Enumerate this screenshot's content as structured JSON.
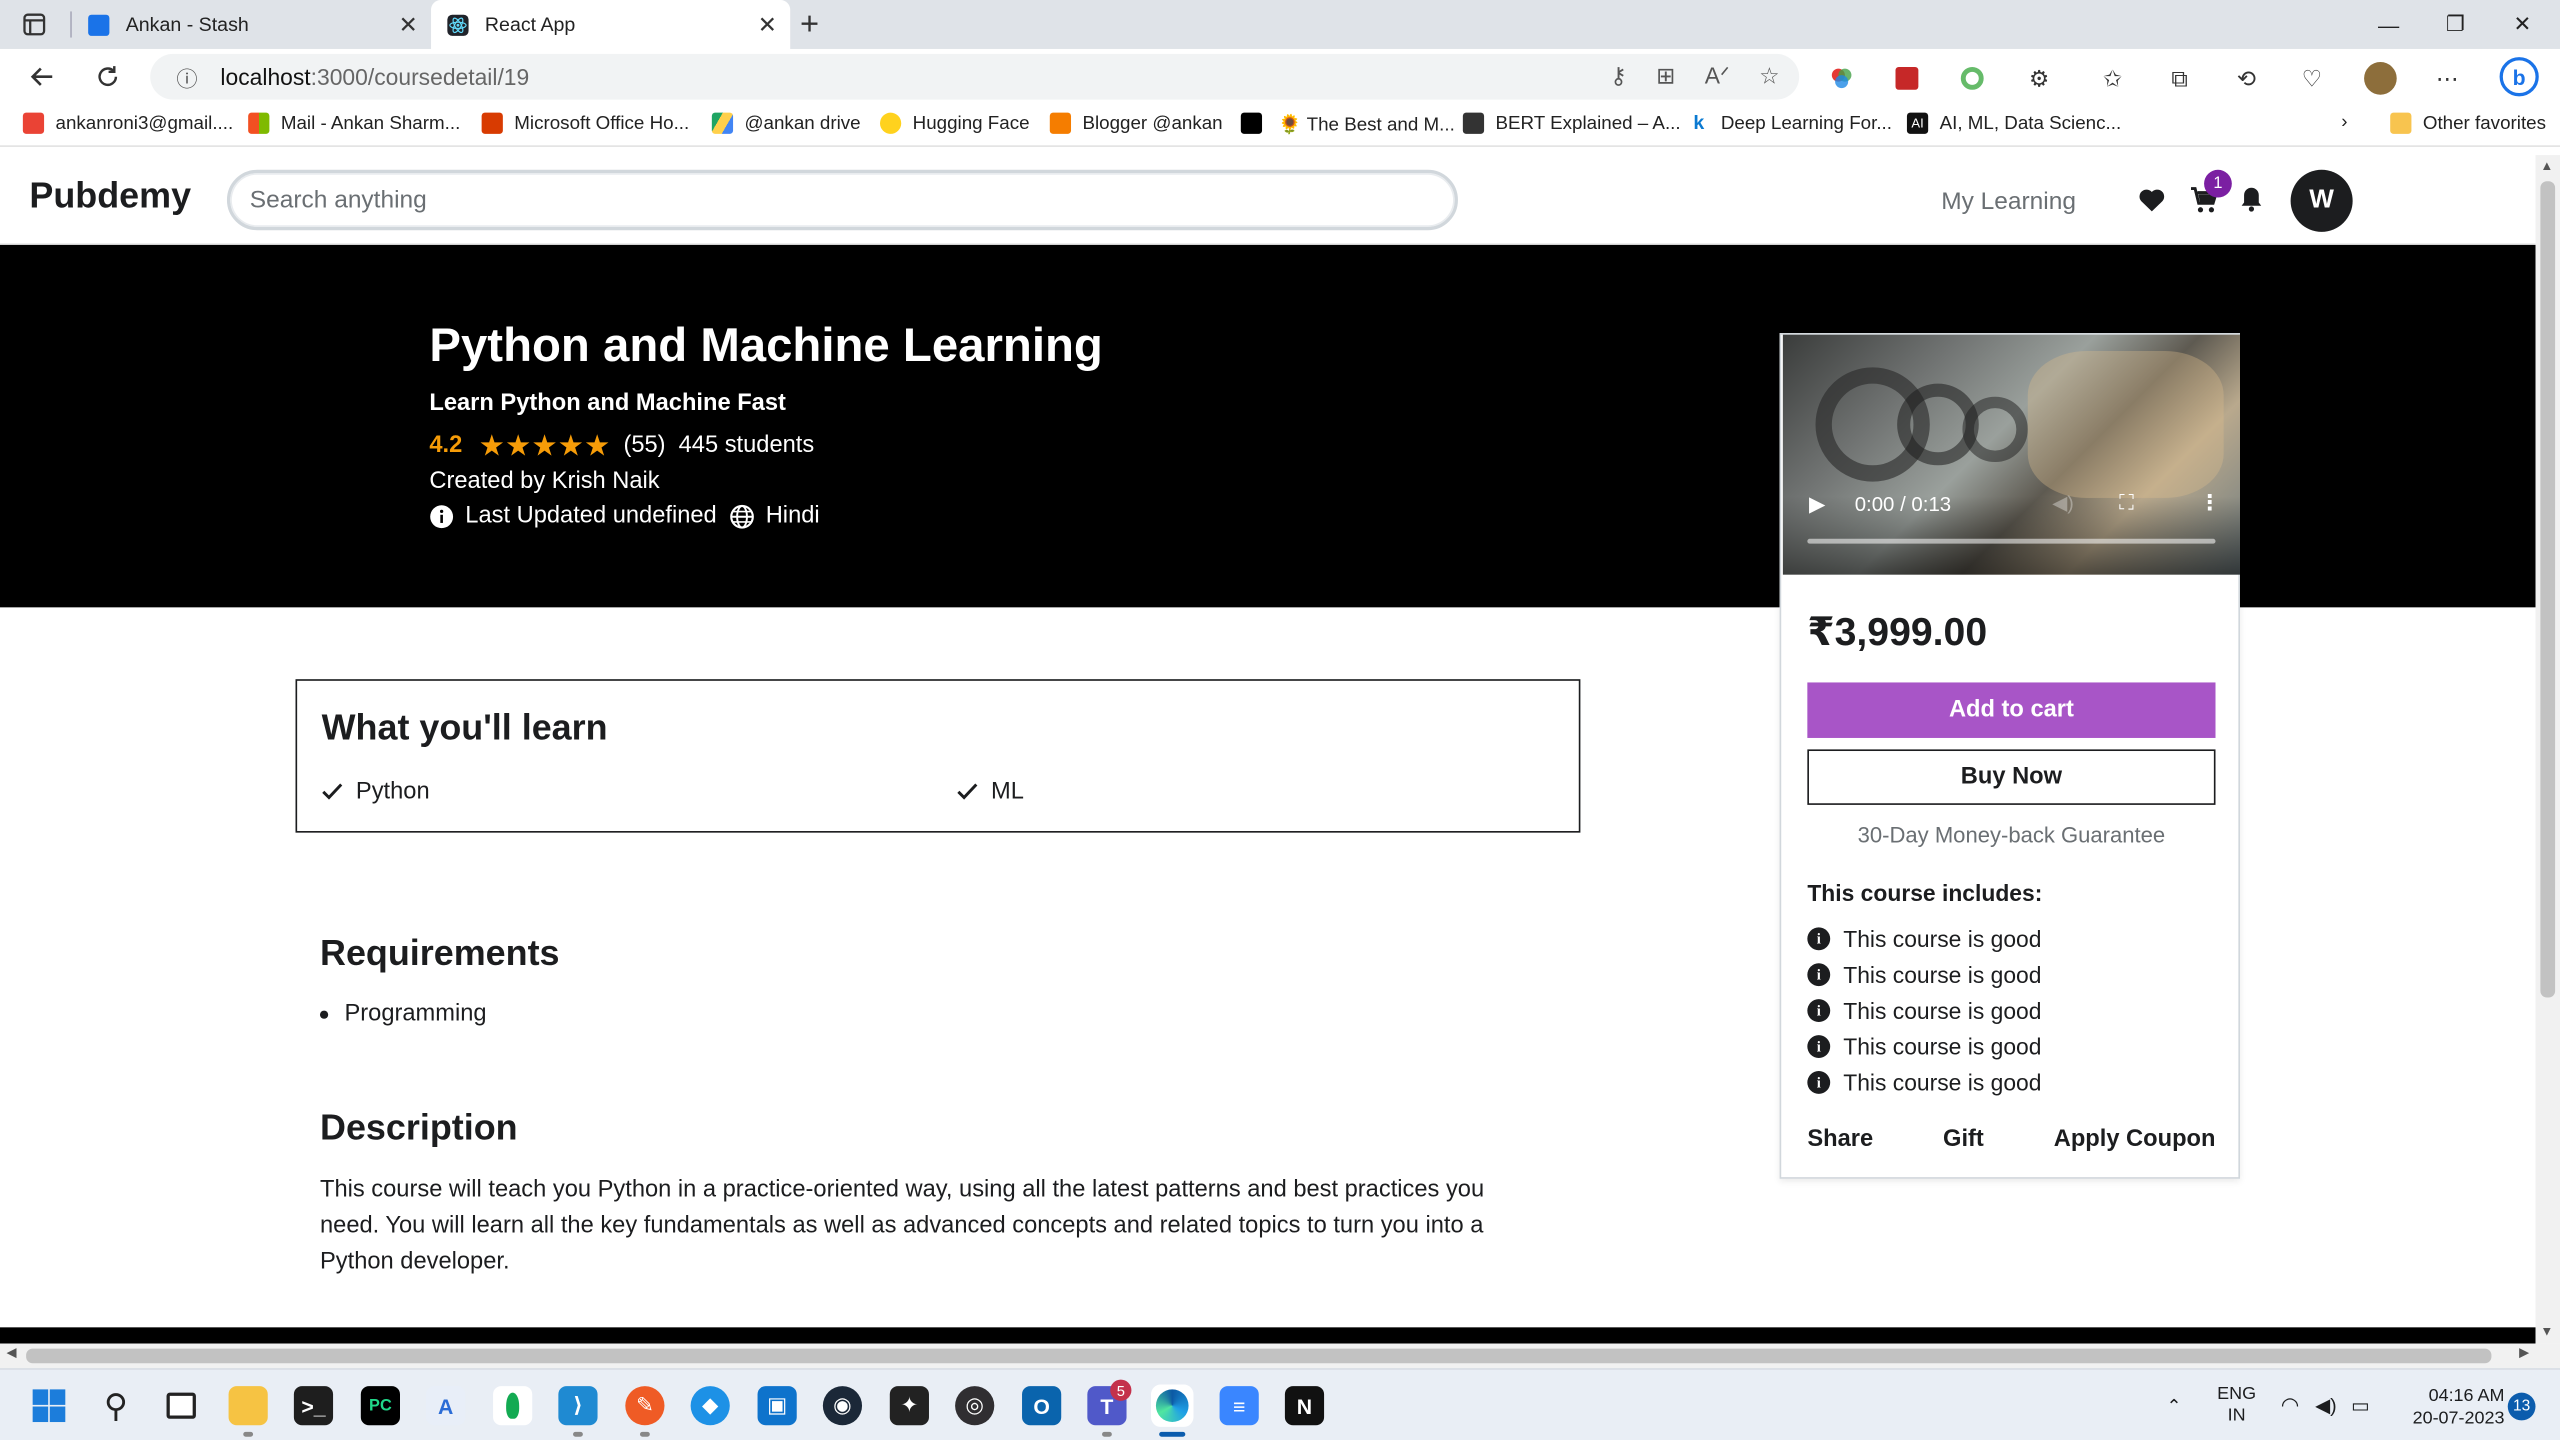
{
  "browser": {
    "tabs": [
      {
        "title": "Ankan - Stash",
        "active": false,
        "color": "#1a73e8"
      },
      {
        "title": "React App",
        "active": true,
        "color": "#20232a"
      }
    ],
    "url_host": "localhost",
    "url_path": ":3000/coursedetail/19",
    "favorites": [
      {
        "label": "ankanroni3@gmail....",
        "color": "#ea4335"
      },
      {
        "label": "Mail - Ankan Sharm...",
        "color": "#f25022"
      },
      {
        "label": "Microsoft Office Ho...",
        "color": "#d83b01"
      },
      {
        "label": "@ankan drive",
        "color": "#1fa463"
      },
      {
        "label": "Hugging Face",
        "color": "#ffd21e"
      },
      {
        "label": "Blogger @ankan",
        "color": "#f57d00"
      },
      {
        "label": "",
        "color": "#000000"
      },
      {
        "label": "🌻 The Best and M...",
        "color": "#ffffff"
      },
      {
        "label": "BERT Explained – A...",
        "color": "#333333"
      },
      {
        "label": "Deep Learning For...",
        "color": "#0b7ad1"
      },
      {
        "label": "AI, ML, Data Scienc...",
        "color": "#111111"
      }
    ],
    "other_favorites": "Other favorites"
  },
  "header": {
    "brand": "Pubdemy",
    "search_placeholder": "Search anything",
    "my_learning": "My Learning",
    "cart_count": "1",
    "avatar_initial": "W"
  },
  "course": {
    "title": "Python and Machine Learning",
    "subtitle": "Learn Python and Machine Fast",
    "rating": "4.2",
    "stars": 5,
    "reviews": "(55)",
    "students": "445 students",
    "created_by": "Created by Krish Naik",
    "last_updated": "Last Updated undefined",
    "language": "Hindi"
  },
  "sidebar_card": {
    "video_time": "0:00 / 0:13",
    "price": "₹3,999.00",
    "add_to_cart": "Add to cart",
    "buy_now": "Buy Now",
    "guarantee": "30-Day Money-back Guarantee",
    "includes_title": "This course includes:",
    "includes": [
      "This course is good",
      "This course is good",
      "This course is good",
      "This course is good",
      "This course is good"
    ],
    "share": "Share",
    "gift": "Gift",
    "apply_coupon": "Apply Coupon",
    "accent_color": "#a855c7"
  },
  "learn": {
    "title": "What you'll learn",
    "items": [
      "Python",
      "ML"
    ]
  },
  "requirements": {
    "title": "Requirements",
    "items": [
      "Programming"
    ]
  },
  "description": {
    "title": "Description",
    "text": "This course will teach you Python in a practice-oriented way, using all the latest patterns and best practices you need. You will learn all the key fundamentals as well as advanced concepts and related topics to turn you into a Python developer."
  },
  "taskbar": {
    "lang_top": "ENG",
    "lang_bottom": "IN",
    "time": "04:16 AM",
    "date": "20-07-2023",
    "notifications": "13",
    "teams_badge": "5"
  }
}
